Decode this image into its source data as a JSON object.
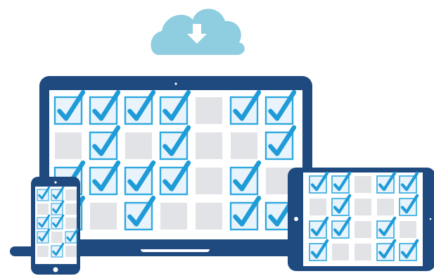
{
  "colors": {
    "device_frame": "#1e4a80",
    "screen_bg": "#ffffff",
    "empty_cell": "#e1e3e6",
    "check_box_fill": "#e8f3fb",
    "check_box_border": "#2ea8df",
    "check_mark": "#1f9bd8",
    "cloud": "#8fcde0",
    "download_arrow": "#ffffff",
    "camera_dot": "#ffffff"
  },
  "icons": {
    "cloud": "cloud-download-icon",
    "checked_cell": "checkmark-icon",
    "empty_cell": "empty-square"
  },
  "laptop": {
    "grid": [
      [
        1,
        1,
        1,
        1,
        0,
        1,
        1
      ],
      [
        0,
        1,
        0,
        1,
        0,
        0,
        1
      ],
      [
        1,
        1,
        1,
        1,
        0,
        1,
        0
      ],
      [
        1,
        0,
        1,
        0,
        0,
        1,
        1
      ]
    ]
  },
  "tablet": {
    "grid": [
      [
        1,
        1,
        0,
        1,
        1
      ],
      [
        0,
        1,
        0,
        0,
        1
      ],
      [
        1,
        1,
        0,
        1,
        0
      ],
      [
        1,
        0,
        0,
        1,
        1
      ]
    ]
  },
  "phone": {
    "grid": [
      [
        1,
        1,
        0
      ],
      [
        0,
        1,
        0
      ],
      [
        1,
        1,
        0
      ],
      [
        1,
        0,
        1
      ],
      [
        0,
        1,
        0
      ]
    ]
  }
}
